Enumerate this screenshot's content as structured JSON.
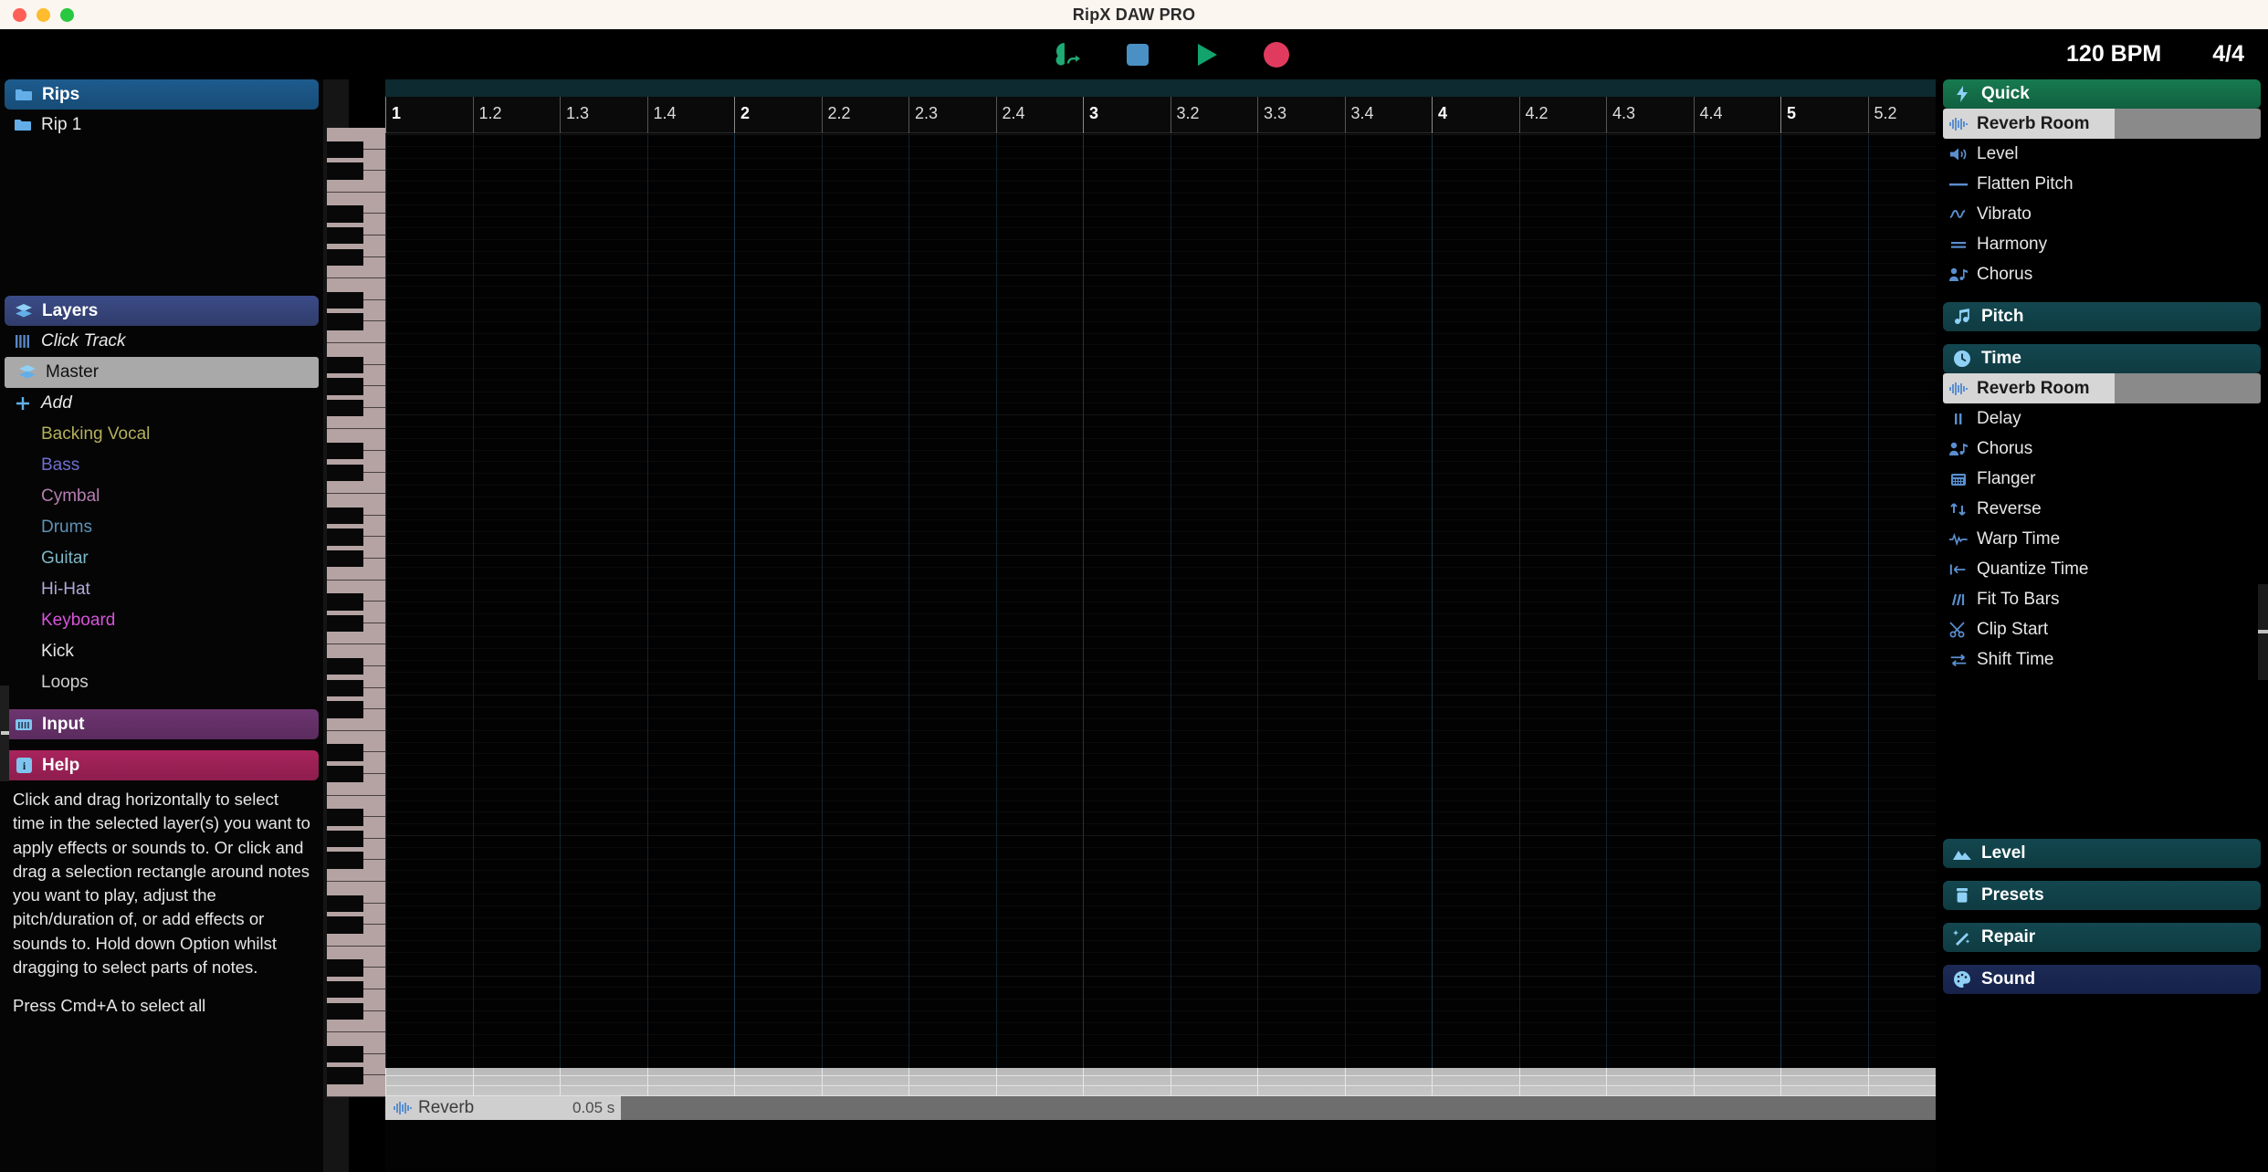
{
  "window": {
    "title": "RipX DAW PRO",
    "traffic_lights": [
      "close-red",
      "minimize-yellow",
      "maximize-green"
    ]
  },
  "transport": {
    "buttons": [
      {
        "name": "rip-audio-button",
        "icon": "brain-arrow-icon",
        "color": "#1faa74"
      },
      {
        "name": "stop-button",
        "icon": "stop-square-icon",
        "color": "#4a90c4"
      },
      {
        "name": "play-button",
        "icon": "play-triangle-icon",
        "color": "#13a36c"
      },
      {
        "name": "record-button",
        "icon": "record-circle-icon",
        "color": "#e03b5e"
      }
    ],
    "bpm": "120 BPM",
    "time_signature": "4/4"
  },
  "sidebar": {
    "rips": {
      "header": "Rips",
      "header_icon": "folder-icon",
      "items": [
        {
          "label": "Rip 1",
          "icon": "folder-icon"
        }
      ]
    },
    "layers": {
      "header": "Layers",
      "header_icon": "layers-icon",
      "click_track": {
        "label": "Click Track",
        "icon": "click-track-icon"
      },
      "master": {
        "label": "Master",
        "icon": "layers-icon"
      },
      "add": {
        "label": "Add",
        "icon": "plus-icon"
      },
      "instruments": [
        {
          "label": "Backing Vocal",
          "color": "#b3b05a"
        },
        {
          "label": "Bass",
          "color": "#6f6fd0"
        },
        {
          "label": "Cymbal",
          "color": "#b57fb0"
        },
        {
          "label": "Drums",
          "color": "#5e92b5"
        },
        {
          "label": "Guitar",
          "color": "#7fb6c4"
        },
        {
          "label": "Hi-Hat",
          "color": "#b0a8d8"
        },
        {
          "label": "Keyboard",
          "color": "#d455d8"
        },
        {
          "label": "Kick",
          "color": "#e8e8e8"
        },
        {
          "label": "Loops",
          "color": "#cfcfcf"
        }
      ]
    },
    "input": {
      "header": "Input",
      "header_icon": "keyboard-icon"
    },
    "help": {
      "header": "Help",
      "header_icon": "info-icon",
      "paragraph_1": "Click and drag horizontally to select time in the selected layer(s) you want to apply effects or sounds to. Or click and drag a selection rectangle around notes you want to play, adjust the pitch/duration of, or add effects or sounds to. Hold down Option whilst dragging to select parts of notes.",
      "paragraph_2": "Press Cmd+A to select all"
    }
  },
  "timeline": {
    "ticks": [
      {
        "label": "1",
        "major": true
      },
      {
        "label": "1.2",
        "major": false
      },
      {
        "label": "1.3",
        "major": false
      },
      {
        "label": "1.4",
        "major": false
      },
      {
        "label": "2",
        "major": true
      },
      {
        "label": "2.2",
        "major": false
      },
      {
        "label": "2.3",
        "major": false
      },
      {
        "label": "2.4",
        "major": false
      },
      {
        "label": "3",
        "major": true
      },
      {
        "label": "3.2",
        "major": false
      },
      {
        "label": "3.3",
        "major": false
      },
      {
        "label": "3.4",
        "major": false
      },
      {
        "label": "4",
        "major": true
      },
      {
        "label": "4.2",
        "major": false
      },
      {
        "label": "4.3",
        "major": false
      },
      {
        "label": "4.4",
        "major": false
      },
      {
        "label": "5",
        "major": true
      },
      {
        "label": "5.2",
        "major": false
      }
    ]
  },
  "effect_lane": {
    "label": "Reverb",
    "icon": "waveform-icon",
    "value": "0.05 s"
  },
  "right_panel": {
    "quick": {
      "header": "Quick",
      "header_icon": "lightning-icon",
      "items": [
        {
          "label": "Reverb Room",
          "icon": "waveform-icon",
          "active": true
        },
        {
          "label": "Level",
          "icon": "speaker-icon",
          "active": false
        },
        {
          "label": "Flatten Pitch",
          "icon": "flat-line-icon",
          "active": false
        },
        {
          "label": "Vibrato",
          "icon": "sine-wave-icon",
          "active": false
        },
        {
          "label": "Harmony",
          "icon": "equals-icon",
          "active": false
        },
        {
          "label": "Chorus",
          "icon": "person-music-icon",
          "active": false
        }
      ]
    },
    "pitch": {
      "header": "Pitch",
      "header_icon": "music-note-icon"
    },
    "time": {
      "header": "Time",
      "header_icon": "clock-icon",
      "items": [
        {
          "label": "Reverb Room",
          "icon": "waveform-icon",
          "active": true
        },
        {
          "label": "Delay",
          "icon": "pause-bars-icon",
          "active": false
        },
        {
          "label": "Chorus",
          "icon": "person-music-icon",
          "active": false
        },
        {
          "label": "Flanger",
          "icon": "amp-cabinet-icon",
          "active": false
        },
        {
          "label": "Reverse",
          "icon": "swap-vertical-icon",
          "active": false
        },
        {
          "label": "Warp Time",
          "icon": "pulse-wave-icon",
          "active": false
        },
        {
          "label": "Quantize Time",
          "icon": "snap-left-icon",
          "active": false
        },
        {
          "label": "Fit To Bars",
          "icon": "slanted-bars-icon",
          "active": false
        },
        {
          "label": "Clip Start",
          "icon": "scissors-icon",
          "active": false
        },
        {
          "label": "Shift Time",
          "icon": "swap-horizontal-icon",
          "active": false
        }
      ]
    },
    "footer_sections": [
      {
        "label": "Level",
        "icon": "mountains-icon",
        "style": "teal"
      },
      {
        "label": "Presets",
        "icon": "jar-icon",
        "style": "teal"
      },
      {
        "label": "Repair",
        "icon": "magic-wand-icon",
        "style": "teal"
      },
      {
        "label": "Sound",
        "icon": "palette-icon",
        "style": "navy"
      }
    ]
  },
  "colors": {
    "accent_green": "#177a4f",
    "accent_teal": "#13474f",
    "accent_navy": "#1b2a55",
    "icon_blue": "#6fa8dc",
    "selection_grey": "#a9a9a9"
  }
}
